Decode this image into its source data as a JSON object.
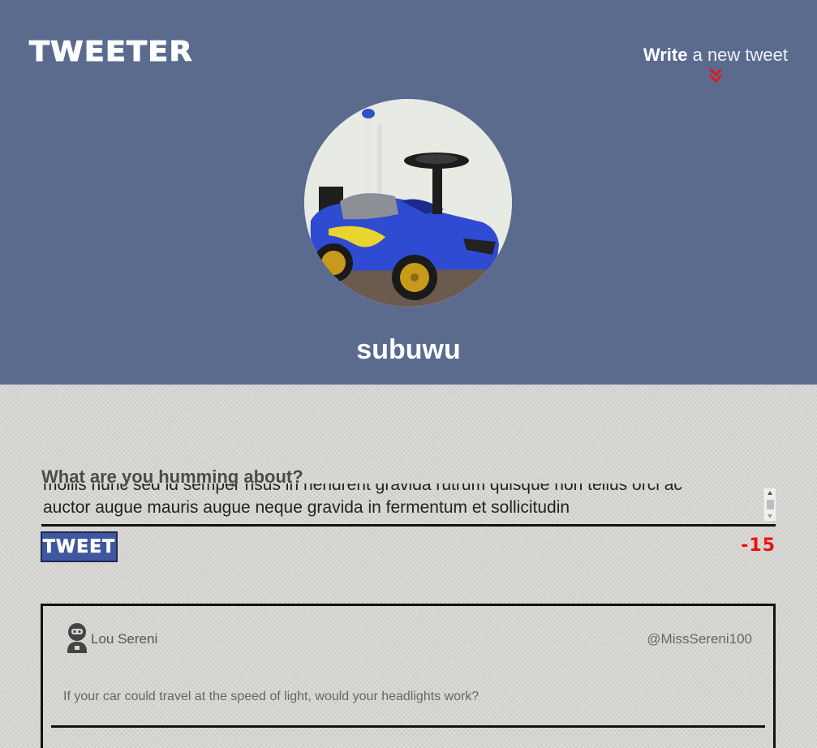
{
  "header": {
    "logo": "TWEETER",
    "compose_toggle": {
      "bold": "Write",
      "light": " a new tweet"
    },
    "chevron_color": "#e01b1b",
    "username": "subuwu"
  },
  "compose": {
    "label": "What are you humming about?",
    "text_line_1": "mollis nunc sed id semper risus in hendrerit gravida rutrum quisque non tellus orci ac",
    "text_line_2": "auctor augue mauris augue neque gravida in fermentum et sollicitudin",
    "button_label": "TWEET",
    "char_counter": "-15"
  },
  "tweets": [
    {
      "avatar_icon": "robot-avatar-icon",
      "user_name": "Lou Sereni",
      "handle": "@MissSereni100",
      "content": "If your car could travel at the speed of light, would your headlights work?"
    }
  ],
  "colors": {
    "header_bg": "#5a6b8e",
    "tweet_button_bg": "#3f56a0",
    "counter_negative": "#ee0f0f",
    "page_bg": "#d9d8d5"
  }
}
